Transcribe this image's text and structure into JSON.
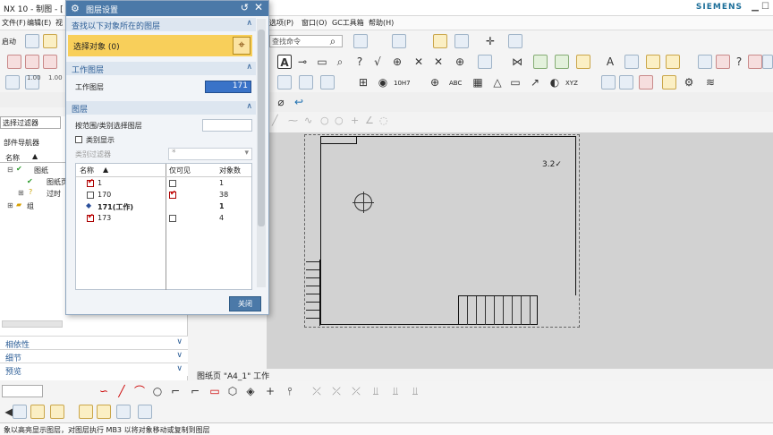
{
  "app": {
    "title": "NX 10 - 制图 - [",
    "brand": "SIEMENS",
    "window_controls": "▁ ☐"
  },
  "menubar": {
    "left_items": [
      "文件(F)",
      "编辑(E)",
      "视"
    ],
    "right_items": [
      "选项(P)",
      "窗口(O)",
      "GC工具箱",
      "帮助(H)"
    ],
    "cmd_finder_placeholder": "查找命令"
  },
  "toolbar": {
    "start_label": "启动",
    "spin_values": [
      "1.00",
      "1.00",
      "1.00"
    ],
    "note_label": "ABC",
    "xyz_label": "XYZ",
    "h7_label": "10H7"
  },
  "nav": {
    "filter_value": "选择过滤器",
    "title": "部件导航器",
    "col_name": "名称",
    "tree": [
      {
        "label": "图纸",
        "level": 0
      },
      {
        "label": "图纸页",
        "level": 1
      },
      {
        "label": "过时",
        "level": 1
      },
      {
        "label": "组",
        "level": 0
      }
    ],
    "panels": [
      "相依性",
      "细节",
      "预览"
    ]
  },
  "dialog": {
    "title": "图层设置",
    "sec_find": "查找以下对象所在的图层",
    "select_objects": "选择对象 (0)",
    "sec_work": "工作图层",
    "work_layer_label": "工作图层",
    "work_layer_value": "171",
    "sec_layers": "图层",
    "by_range_label": "按范围/类别选择图层",
    "category_display": "类别显示",
    "category_filter": "类别过滤器",
    "category_filter_value": "*",
    "table_headers": [
      "名称",
      "仅可见",
      "对象数"
    ],
    "rows": [
      {
        "name": "1",
        "visible_only": false,
        "count": "1",
        "checked": true
      },
      {
        "name": "170",
        "visible_only": true,
        "count": "38",
        "checked": false
      },
      {
        "name": "171(工作)",
        "visible_only": false,
        "count": "1",
        "checked": null
      },
      {
        "name": "173",
        "visible_only": false,
        "count": "4",
        "checked": true
      }
    ],
    "close_label": "关闭"
  },
  "canvas": {
    "status_text": "图纸页 \"A4_1\" 工作",
    "annotation": "3.2✓"
  },
  "statusbar": {
    "text": "象以高亮显示图层，对图层执行 MB3 以将对象移动或复制到图层"
  }
}
